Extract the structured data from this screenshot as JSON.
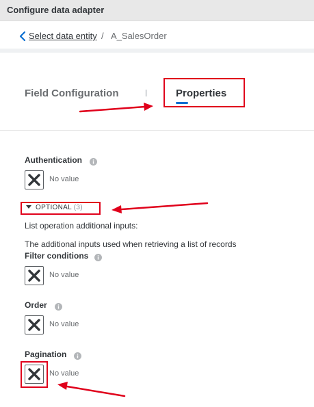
{
  "window": {
    "title": "Configure data adapter"
  },
  "breadcrumb": {
    "link_label": "Select data entity",
    "separator": "/",
    "current": "A_SalesOrder"
  },
  "tabs": {
    "field_configuration": "Field Configuration",
    "properties": "Properties",
    "active": "Properties"
  },
  "fields": {
    "authentication": {
      "label": "Authentication",
      "value": "No value"
    },
    "filter_conditions": {
      "label": "Filter conditions",
      "value": "No value"
    },
    "order": {
      "label": "Order",
      "value": "No value"
    },
    "pagination": {
      "label": "Pagination",
      "value": "No value"
    }
  },
  "optional_section": {
    "label": "OPTIONAL",
    "count": "(3)",
    "heading": "List operation additional inputs:",
    "description": "The additional inputs used when retrieving a list of records"
  },
  "icons": {
    "back": "chevron-left-icon",
    "info": "info-icon",
    "no_value": "close-icon",
    "optional_caret": "caret-down-icon"
  },
  "colors": {
    "accent": "#0a6ed1",
    "annotation": "#e0001b",
    "titlebar": "#e8e8e8"
  }
}
